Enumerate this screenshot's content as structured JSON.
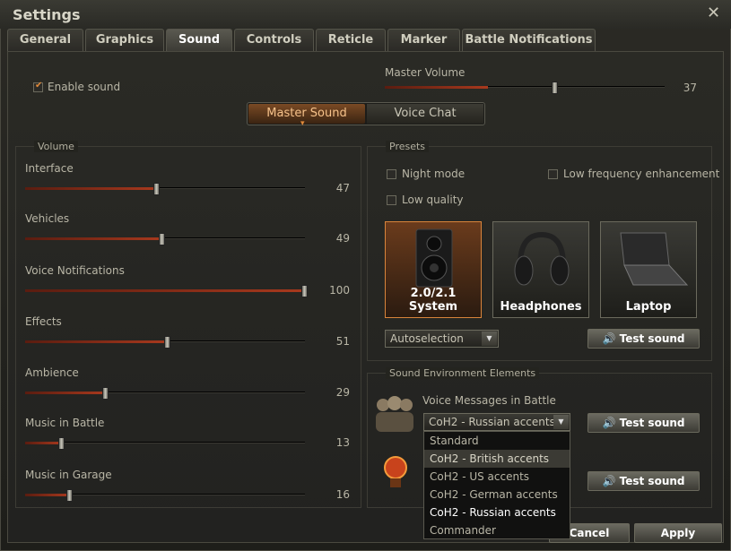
{
  "window": {
    "title": "Settings"
  },
  "tabs": [
    {
      "label": "General"
    },
    {
      "label": "Graphics"
    },
    {
      "label": "Sound",
      "active": true
    },
    {
      "label": "Controls"
    },
    {
      "label": "Reticle"
    },
    {
      "label": "Marker"
    },
    {
      "label": "Battle Notifications"
    }
  ],
  "top": {
    "enable_sound_label": "Enable sound",
    "enable_sound_checked": true,
    "master_volume_label": "Master Volume",
    "master_volume_value": "37",
    "master_volume_level": 37
  },
  "mode_toggle": {
    "master_sound": "Master Sound",
    "voice_chat": "Voice Chat",
    "active": "master_sound"
  },
  "volume": {
    "group_label": "Volume",
    "sliders": [
      {
        "label": "Interface",
        "value": "47",
        "level": 47
      },
      {
        "label": "Vehicles",
        "value": "49",
        "level": 49
      },
      {
        "label": "Voice Notifications",
        "value": "100",
        "level": 100
      },
      {
        "label": "Effects",
        "value": "51",
        "level": 51
      },
      {
        "label": "Ambience",
        "value": "29",
        "level": 29
      },
      {
        "label": "Music in Battle",
        "value": "13",
        "level": 13
      },
      {
        "label": "Music in Garage",
        "value": "16",
        "level": 16
      }
    ]
  },
  "presets": {
    "group_label": "Presets",
    "night_mode": "Night mode",
    "low_frequency": "Low frequency enhancement",
    "low_quality": "Low quality",
    "cards": [
      {
        "label": "2.0/2.1 System",
        "icon": "speaker-icon",
        "active": true
      },
      {
        "label": "Headphones",
        "icon": "headphones-icon",
        "active": false
      },
      {
        "label": "Laptop",
        "icon": "laptop-icon",
        "active": false
      }
    ],
    "dropdown_value": "Autoselection",
    "test_sound": "Test sound"
  },
  "environment": {
    "group_label": "Sound Environment Elements",
    "voice_messages_label": "Voice Messages in Battle",
    "voice_dropdown_value": "CoH2 - Russian accents",
    "test_sound_1": "Test sound",
    "test_sound_2": "Test sound",
    "options": [
      "Standard",
      "CoH2 - British accents",
      "CoH2 - US accents",
      "CoH2 - German accents",
      "CoH2 - Russian accents",
      "Commander"
    ]
  },
  "footer": {
    "cancel": "Cancel",
    "apply": "Apply"
  },
  "colors": {
    "accent": "#e08a3a",
    "slider_fill": "#a8391d"
  }
}
